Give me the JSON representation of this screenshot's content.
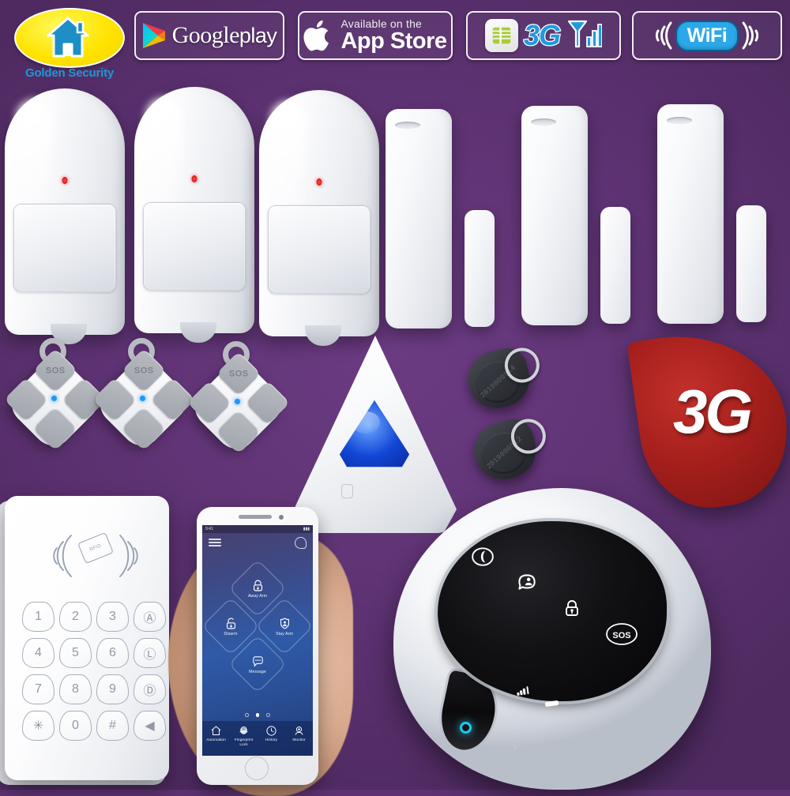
{
  "meta": {
    "background_color": "#5D3272",
    "accent_red": "#A41F1C",
    "accent_blue": "#1E9BE0",
    "logo_yellow": "#FFE300"
  },
  "header": {
    "logo": {
      "brand_name": "Golden Security",
      "icon": "house-icon"
    },
    "badges": [
      {
        "id": "google-play",
        "icon": "google-play-triangle-icon",
        "line1": "Google",
        "line2": "play"
      },
      {
        "id": "app-store",
        "icon": "apple-logo-icon",
        "line1": "Available on the",
        "line2": "App Store"
      },
      {
        "id": "sim-3g",
        "icon": "sim-card-icon",
        "label": "3G",
        "signal_icon": "signal-bars-icon"
      },
      {
        "id": "wifi",
        "label": "WiFi",
        "icon": "wifi-waves-icon"
      }
    ]
  },
  "products": {
    "pir_detectors": {
      "name": "PIR Motion Detector",
      "count": 3,
      "led_color": "#FF3B3B"
    },
    "door_contacts": {
      "name": "Door Window Contact Sensor",
      "count": 3
    },
    "remotes": {
      "name": "Remote Key Fob",
      "count": 3,
      "buttons": [
        {
          "id": "sos",
          "label": "SOS"
        },
        {
          "id": "arm",
          "label": ""
        },
        {
          "id": "disarm",
          "label": ""
        },
        {
          "id": "home-arm",
          "label": ""
        }
      ]
    },
    "siren": {
      "name": "Wireless Strobe Siren",
      "lens_color": "#1246D6"
    },
    "rfid_tags": {
      "name": "RFID Key Tag",
      "count": 2,
      "serials": [
        "2019000514",
        "2019000512"
      ]
    },
    "droplet_badge": {
      "label": "3G",
      "color": "#A41F1C"
    },
    "keypad": {
      "name": "RFID Wireless Keypad",
      "rfid_label": "RFID",
      "keys": [
        "1",
        "2",
        "3",
        "Ⓐ",
        "4",
        "5",
        "6",
        "Ⓛ",
        "7",
        "8",
        "9",
        "Ⓓ",
        "✳",
        "0",
        "#",
        "◀"
      ],
      "key_names": [
        "key-1",
        "key-2",
        "key-3",
        "key-away-arm",
        "key-4",
        "key-5",
        "key-6",
        "key-lock",
        "key-7",
        "key-8",
        "key-9",
        "key-disarm",
        "key-star",
        "key-0",
        "key-hash",
        "key-bell"
      ]
    },
    "hub": {
      "name": "3G WiFi Alarm Host Panel",
      "touch_icons": [
        {
          "id": "phone",
          "name": "phone-icon"
        },
        {
          "id": "home",
          "name": "home-arm-icon"
        },
        {
          "id": "lock",
          "name": "lock-arm-icon"
        },
        {
          "id": "sos",
          "name": "sos-icon",
          "label": "SOS"
        }
      ],
      "indicators": {
        "signal": "signal-bars-icon",
        "battery": "battery-icon",
        "power_led_color": "#23C8E8"
      }
    }
  },
  "phone_app": {
    "status_bar": {
      "time": "9:41",
      "right": "▮▮▮"
    },
    "header": {
      "menu_icon": "hamburger-menu-icon",
      "chat_icon": "chat-bubble-icon"
    },
    "actions": [
      {
        "id": "away-arm",
        "label": "Away Arm",
        "icon": "locked-padlock-down-arrow-icon"
      },
      {
        "id": "disarm",
        "label": "Disarm",
        "icon": "unlocked-padlock-icon"
      },
      {
        "id": "stay-arm",
        "label": "Stay Arm",
        "icon": "shield-person-icon"
      },
      {
        "id": "message",
        "label": "Message",
        "icon": "speech-bubble-dots-icon"
      }
    ],
    "page_dots": {
      "count": 3,
      "active_index": 1
    },
    "tabs": [
      {
        "id": "automation",
        "label": "Automation",
        "icon": "house-icon"
      },
      {
        "id": "fingerprint-lock",
        "label": "Fingerprint Lock",
        "icon": "fingerprint-icon"
      },
      {
        "id": "history",
        "label": "History",
        "icon": "clock-icon"
      },
      {
        "id": "monitor",
        "label": "Monitor",
        "icon": "camera-icon"
      }
    ]
  }
}
